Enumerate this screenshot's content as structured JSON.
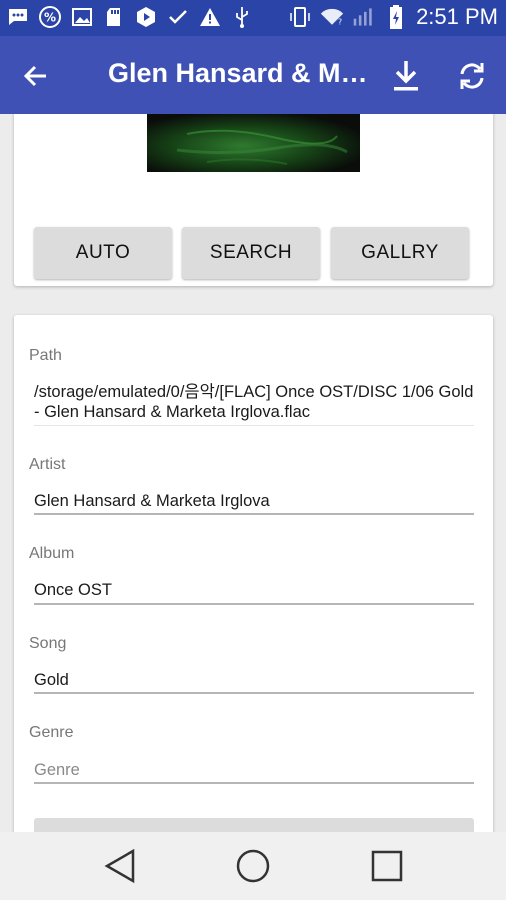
{
  "status_bar": {
    "time": "2:51 PM",
    "left_icons": [
      "message-icon",
      "percent-icon",
      "image-icon",
      "sd-card-icon",
      "play-icon",
      "check-icon",
      "warning-icon",
      "usb-icon"
    ],
    "right_icons": [
      "phone-vibrate-icon",
      "wifi-icon",
      "signal-icon",
      "battery-charging-icon"
    ]
  },
  "app_bar": {
    "title": "Glen Hansard & Marketa Irglova",
    "back_icon": "arrow-back-icon",
    "download_icon": "download-icon",
    "sync_icon": "sync-icon",
    "color": "#3f51b5"
  },
  "cover_buttons": {
    "auto_label": "AUTO",
    "search_label": "SEARCH",
    "gallery_label": "GALLRY"
  },
  "fields": {
    "path": {
      "label": "Path",
      "value": "/storage/emulated/0/음악/[FLAC] Once OST/DISC 1/06 Gold - Glen Hansard & Marketa Irglova.flac"
    },
    "artist": {
      "label": "Artist",
      "value": "Glen Hansard & Marketa Irglova"
    },
    "album": {
      "label": "Album",
      "value": "Once OST"
    },
    "song": {
      "label": "Song",
      "value": "Gold"
    },
    "genre": {
      "label": "Genre",
      "value": "",
      "placeholder": "Genre"
    }
  },
  "nav_bar": {
    "back_icon": "triangle-back-icon",
    "home_icon": "circle-home-icon",
    "recents_icon": "square-recents-icon"
  }
}
